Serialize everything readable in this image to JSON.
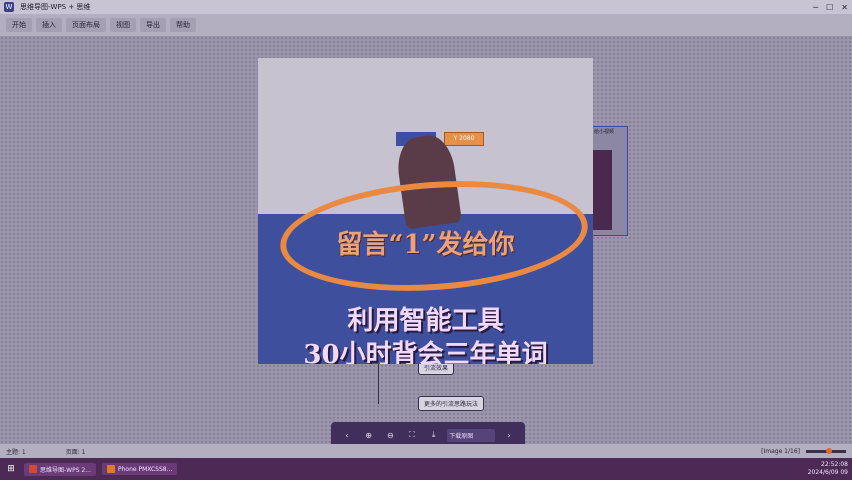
{
  "window": {
    "app_logo": "W",
    "title": "思维导图-WPS + 思维",
    "controls": [
      "─",
      "☐",
      "✕"
    ]
  },
  "toolbar": {
    "tabs": [
      "开始",
      "插入",
      "页面布局",
      "视图",
      "导出",
      "帮助"
    ]
  },
  "mindmap": {
    "nodes": [
      {
        "label": "引流效果"
      },
      {
        "label": "更多的引流思路玩法"
      }
    ],
    "side_label": "给小视频"
  },
  "video": {
    "orange_chip": "Y 2080",
    "promo": "留言“1”发给你",
    "headline_1": "利用智能工具",
    "headline_2": "30小时背会三年单词"
  },
  "viewer_toolbar": {
    "prev": "‹",
    "zoom_in": "⊕",
    "zoom_out": "⊖",
    "fit": "⛶",
    "save": "⤓",
    "download_label": "下载原图",
    "next": "›"
  },
  "statusbar": {
    "left": "主题: 1",
    "middle": "页面: 1",
    "zoom_label": "[Image 1/16]"
  },
  "taskbar": {
    "start": "⊞",
    "tasks": [
      {
        "label": "思维导图-WPS 2...",
        "icon_color": "#d04a3a"
      },
      {
        "label": "Phone PMXCSS8...",
        "icon_color": "#e07a2a"
      }
    ],
    "clock_time": "22:52:08",
    "clock_date": "2024/6/09 09"
  },
  "colors": {
    "accent_orange": "#ea8a42",
    "video_blue": "#3e4f9e",
    "taskbar": "#4c2a55"
  }
}
